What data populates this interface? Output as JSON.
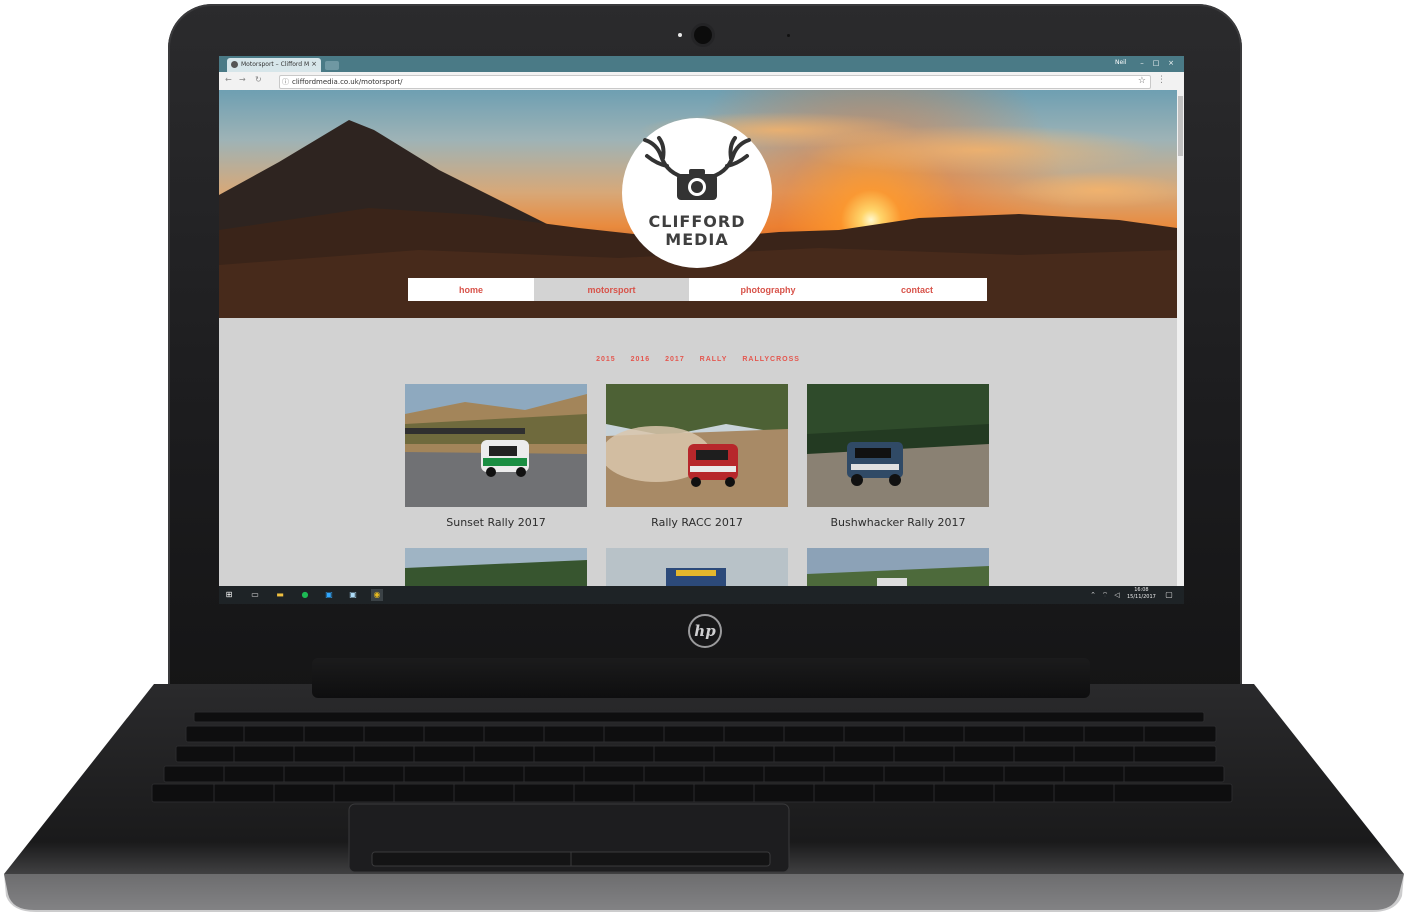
{
  "browser": {
    "tab_title": "Motorsport – Clifford M",
    "tab_close": "×",
    "window_user": "Neil",
    "window_buttons": [
      "–",
      "□",
      "×"
    ],
    "url": "cliffordmedia.co.uk/motorsport/",
    "url_info": "ⓘ",
    "star": "☆",
    "nav": {
      "back": "←",
      "forward": "→",
      "reload": "↻"
    },
    "menu": "⋮"
  },
  "site": {
    "logo_line1": "CLIFFORD",
    "logo_line2": "MEDIA",
    "nav": [
      {
        "label": "home",
        "active": false
      },
      {
        "label": "motorsport",
        "active": true
      },
      {
        "label": "photography",
        "active": false
      },
      {
        "label": "contact",
        "active": false
      }
    ],
    "filters": [
      "2015",
      "2016",
      "2017",
      "RALLY",
      "RALLYCROSS"
    ],
    "gallery": [
      {
        "caption": "Sunset Rally 2017"
      },
      {
        "caption": "Rally RACC 2017"
      },
      {
        "caption": "Bushwhacker Rally 2017"
      }
    ]
  },
  "taskbar": {
    "time": "16:08",
    "date": "15/11/2017",
    "apps": [
      "windows-start",
      "task-view",
      "file-explorer",
      "spotify",
      "photoshop",
      "lightroom",
      "chrome"
    ]
  },
  "device": {
    "brand": "hp"
  },
  "colors": {
    "accent": "#e4574f",
    "nav_active_bg": "#d3d3d3",
    "page_bg": "#d2d2d2"
  }
}
